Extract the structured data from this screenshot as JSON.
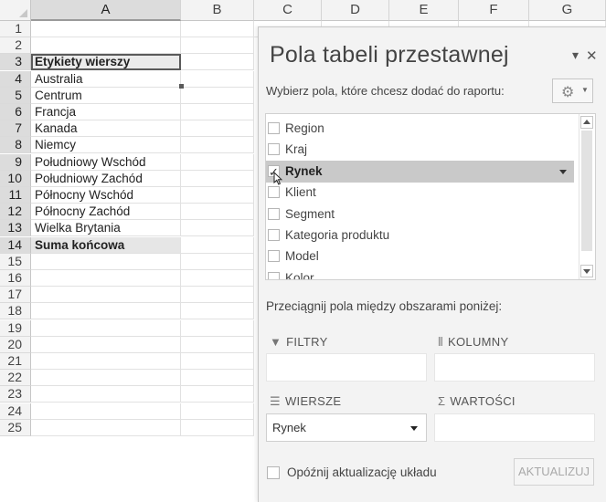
{
  "sheet": {
    "columns": [
      "A",
      "B",
      "C",
      "D",
      "E",
      "F",
      "G"
    ],
    "rows": [
      "1",
      "2",
      "3",
      "4",
      "5",
      "6",
      "7",
      "8",
      "9",
      "10",
      "11",
      "12",
      "13",
      "14",
      "15",
      "16",
      "17",
      "18",
      "19",
      "20",
      "21",
      "22",
      "23",
      "24",
      "25"
    ],
    "col_a_values": [
      "",
      "",
      "Etykiety wierszy",
      "Australia",
      "Centrum",
      "Francja",
      "Kanada",
      "Niemcy",
      "Południowy Wschód",
      "Południowy Zachód",
      "Północny Wschód",
      "Północny Zachód",
      "Wielka Brytania",
      "Suma końcowa"
    ]
  },
  "pane": {
    "title": "Pola tabeli przestawnej",
    "subtitle": "Wybierz pola, które chcesz dodać do raportu:",
    "close_glyph": "✕",
    "menu_glyph": "▾",
    "gear_icon": "gear-icon",
    "fields": [
      {
        "label": "Region",
        "checked": false
      },
      {
        "label": "Kraj",
        "checked": false
      },
      {
        "label": "Rynek",
        "checked": true
      },
      {
        "label": "Klient",
        "checked": false
      },
      {
        "label": "Segment",
        "checked": false
      },
      {
        "label": "Kategoria produktu",
        "checked": false
      },
      {
        "label": "Model",
        "checked": false
      },
      {
        "label": "Kolor",
        "checked": false
      }
    ],
    "drag_hint": "Przeciągnij pola między obszarami poniżej:",
    "areas": {
      "filters": "FILTRY",
      "columns": "KOLUMNY",
      "rows": "WIERSZE",
      "values": "WARTOŚCI",
      "rows_item": "Rynek"
    },
    "defer_label": "Opóźnij aktualizację układu",
    "update_button": "AKTUALIZUJ"
  }
}
